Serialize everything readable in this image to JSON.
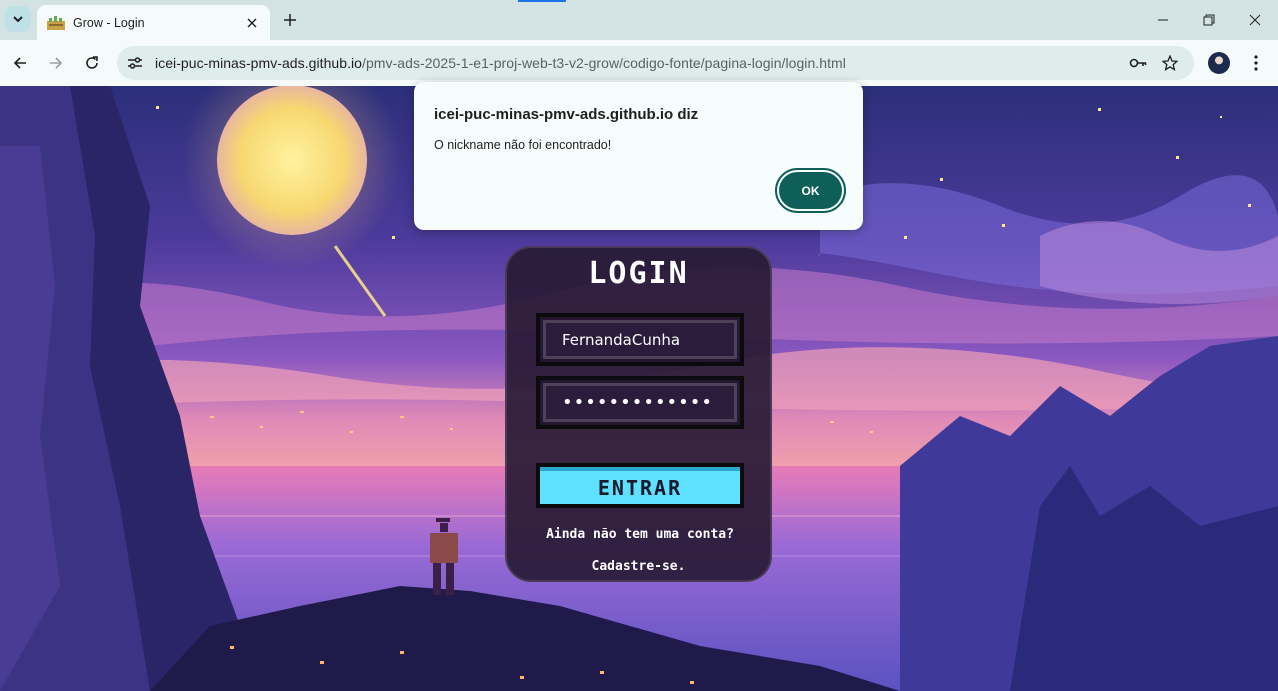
{
  "browser": {
    "tab": {
      "title": "Grow - Login"
    },
    "url": {
      "host": "icei-puc-minas-pmv-ads.github.io",
      "path": "/pmv-ads-2025-1-e1-proj-web-t3-v2-grow/codigo-fonte/pagina-login/login.html"
    },
    "icons": [
      "tab-search-icon",
      "grow-favicon-icon",
      "close-icon",
      "plus-icon",
      "minimize-icon",
      "restore-icon",
      "close-window-icon",
      "back-icon",
      "forward-icon",
      "reload-icon",
      "site-info-icon",
      "key-icon",
      "star-icon",
      "avatar",
      "more-menu-icon"
    ]
  },
  "alert": {
    "title": "icei-puc-minas-pmv-ads.github.io diz",
    "message": "O nickname não foi encontrado!",
    "ok_label": "OK"
  },
  "login": {
    "title": "LOGIN",
    "nickname_value": "FernandaCunha",
    "password_value": "•••••••••••••",
    "enter_label": "ENTRAR",
    "signup_question": "Ainda não tem uma conta?",
    "signup_link": "Cadastre-se."
  },
  "colors": {
    "accent_teal": "#0d5f58",
    "enter_button": "#5ee0ff",
    "card_background": "#281a34"
  }
}
